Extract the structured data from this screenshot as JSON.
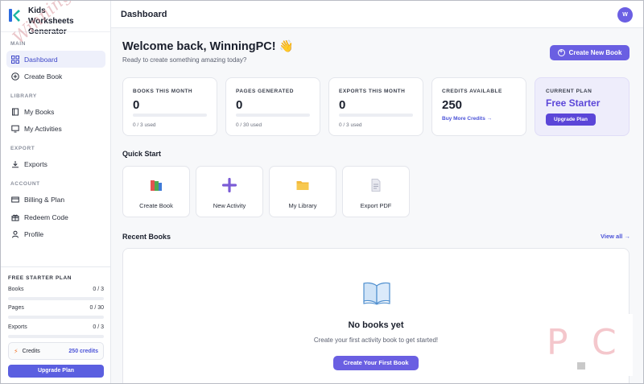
{
  "app": {
    "name": "Kids Worksheets Generator"
  },
  "header": {
    "title": "Dashboard",
    "avatar_initial": "W"
  },
  "sidebar": {
    "sections": [
      {
        "label": "MAIN"
      },
      {
        "label": "LIBRARY"
      },
      {
        "label": "EXPORT"
      },
      {
        "label": "ACCOUNT"
      }
    ],
    "items": [
      {
        "label": "Dashboard",
        "icon": "grid-icon",
        "active": true
      },
      {
        "label": "Create Book",
        "icon": "plus-circle-icon"
      },
      {
        "label": "My Books",
        "icon": "book-icon"
      },
      {
        "label": "My Activities",
        "icon": "monitor-icon"
      },
      {
        "label": "Exports",
        "icon": "download-icon"
      },
      {
        "label": "Billing & Plan",
        "icon": "credit-card-icon"
      },
      {
        "label": "Redeem Code",
        "icon": "gift-icon"
      },
      {
        "label": "Profile",
        "icon": "user-icon"
      }
    ],
    "plan": {
      "title": "FREE STARTER PLAN",
      "usage": [
        {
          "label": "Books",
          "value": "0 / 3"
        },
        {
          "label": "Pages",
          "value": "0 / 30"
        },
        {
          "label": "Exports",
          "value": "0 / 3"
        }
      ],
      "credits_label": "Credits",
      "credits_value": "250 credits",
      "upgrade_label": "Upgrade Plan"
    }
  },
  "main": {
    "welcome": "Welcome back, WinningPC! 👋",
    "subtitle": "Ready to create something amazing today?",
    "create_new_label": "Create New Book",
    "stats": [
      {
        "label": "BOOKS THIS MONTH",
        "value": "0",
        "used": "0 / 3 used",
        "progress": 0
      },
      {
        "label": "PAGES GENERATED",
        "value": "0",
        "used": "0 / 30 used",
        "progress": 0
      },
      {
        "label": "EXPORTS THIS MONTH",
        "value": "0",
        "used": "0 / 3 used",
        "progress": 0
      },
      {
        "label": "CREDITS AVAILABLE",
        "value": "250",
        "link": "Buy More Credits →"
      }
    ],
    "current_plan": {
      "label": "CURRENT PLAN",
      "name": "Free Starter",
      "button": "Upgrade Plan"
    },
    "quick_start": {
      "title": "Quick Start",
      "items": [
        {
          "label": "Create Book",
          "icon": "books-icon"
        },
        {
          "label": "New Activity",
          "icon": "plus-icon"
        },
        {
          "label": "My Library",
          "icon": "folder-icon"
        },
        {
          "label": "Export PDF",
          "icon": "document-icon"
        }
      ]
    },
    "recent_books": {
      "title": "Recent Books",
      "view_all": "View all →",
      "empty_title": "No books yet",
      "empty_subtitle": "Create your first activity book to get started!",
      "empty_button": "Create Your First Book"
    }
  },
  "watermark": {
    "text": "WinningPC",
    "corner_mark": "P C"
  },
  "colors": {
    "accent": "#6a5fe2",
    "plan_name": "#5b46d8",
    "link": "#4b53d8",
    "bolt": "#f2762e"
  }
}
